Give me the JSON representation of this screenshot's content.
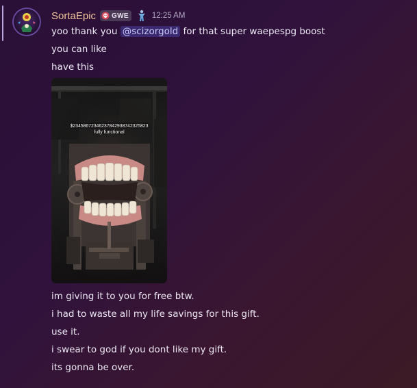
{
  "message": {
    "author": {
      "username": "SortaEpic",
      "role_tag": "GWE",
      "role_tag_icon": "skull-icon",
      "extra_icon": "figure-icon",
      "avatar_icon": "avatar-image"
    },
    "timestamp": "12:25 AM",
    "lines_before": {
      "first_prefix": "yoo thank you ",
      "mention": "@scizorgold",
      "first_suffix": " for that super waepespg boost",
      "second": "you can like",
      "third": "have this"
    },
    "attachment": {
      "caption_line1": "$23458672346237842938742325823",
      "caption_line2": "fully functional"
    },
    "lines_after": [
      "im giving it to you for free btw.",
      "i had to waste all my life savings for this gift.",
      "use it.",
      "i swear to god if you dont like my gift.",
      "its gonna be over."
    ]
  },
  "colors": {
    "username": "#f2c49b",
    "mention_bg": "#5865f2",
    "background_start": "#2a0f36",
    "background_end": "#3c1a25"
  }
}
